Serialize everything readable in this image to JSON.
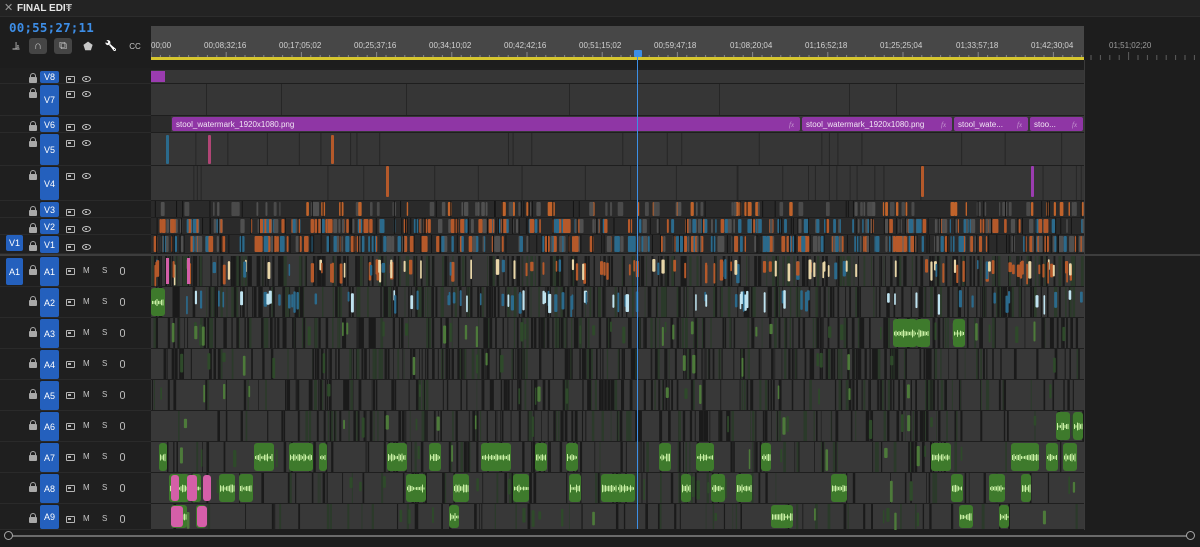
{
  "panel": {
    "title": "FINAL EDIT",
    "close_icon": "close-icon",
    "menu_icon": "panel-menu-icon"
  },
  "timecode": "00;55;27;11",
  "tools": [
    {
      "name": "insert-nest-icon",
      "glyph": "⫡",
      "active": false
    },
    {
      "name": "snap-icon",
      "glyph": "∩",
      "active": true
    },
    {
      "name": "linked-selection-icon",
      "glyph": "⧉",
      "active": true
    },
    {
      "name": "add-marker-icon",
      "glyph": "⬟",
      "active": false
    },
    {
      "name": "wrench-icon",
      "glyph": "🔧",
      "active": false
    },
    {
      "name": "captions-icon",
      "glyph": "CC",
      "active": false
    }
  ],
  "ruler": {
    "labels": [
      "00;00",
      "00;08;32;16",
      "00;17;05;02",
      "00;25;37;16",
      "00;34;10;02",
      "00;42;42;16",
      "00;51;15;02",
      "00;59;47;18",
      "01;08;20;04",
      "01;16;52;18",
      "01;25;25;04",
      "01;33;57;18",
      "01;42;30;04"
    ],
    "ext_label": "01;51;02;20"
  },
  "colors": {
    "accent_blue": "#2460bd",
    "playhead": "#3c8fe6",
    "workarea": "#d6c62f",
    "clip_purple": "#9b3cb0",
    "clip_orange": "#b5592a",
    "clip_blue": "#2b6a8c",
    "clip_green": "#7dc54a",
    "clip_pink": "#d45fa8",
    "track_gray": "#3a3a3a"
  },
  "video_tracks": [
    {
      "id": "V8",
      "label": "V8",
      "clip_label": ""
    },
    {
      "id": "V7",
      "label": "V7",
      "clip_label": ""
    },
    {
      "id": "V6",
      "label": "V6",
      "clip_label": ""
    },
    {
      "id": "V5",
      "label": "V5",
      "clip_label": ""
    },
    {
      "id": "V4",
      "label": "V4",
      "clip_label": ""
    },
    {
      "id": "V3",
      "label": "V3",
      "clip_label": ""
    },
    {
      "id": "V2",
      "label": "V2",
      "clip_label": ""
    },
    {
      "id": "V1",
      "label": "V1",
      "source": "V1"
    }
  ],
  "audio_tracks": [
    {
      "id": "A1",
      "label": "A1",
      "source": "A1",
      "m": "M",
      "s": "S"
    },
    {
      "id": "A2",
      "label": "A2",
      "m": "M",
      "s": "S"
    },
    {
      "id": "A3",
      "label": "A3",
      "m": "M",
      "s": "S"
    },
    {
      "id": "A4",
      "label": "A4",
      "m": "M",
      "s": "S"
    },
    {
      "id": "A5",
      "label": "A5",
      "m": "M",
      "s": "S"
    },
    {
      "id": "A6",
      "label": "A6",
      "m": "M",
      "s": "S"
    },
    {
      "id": "A7",
      "label": "A7",
      "m": "M",
      "s": "S"
    },
    {
      "id": "A8",
      "label": "A8",
      "m": "M",
      "s": "S"
    },
    {
      "id": "A9",
      "label": "A9",
      "m": "M",
      "s": "S"
    }
  ],
  "v6_clips": [
    {
      "label": "stool_watermark_1920x1080.png",
      "fx": "fx"
    },
    {
      "label": "stool_watermark_1920x1080.png",
      "fx": "fx"
    },
    {
      "label": "stool_wate...",
      "fx": "fx"
    },
    {
      "label": "stoo...",
      "fx": "fx"
    }
  ]
}
